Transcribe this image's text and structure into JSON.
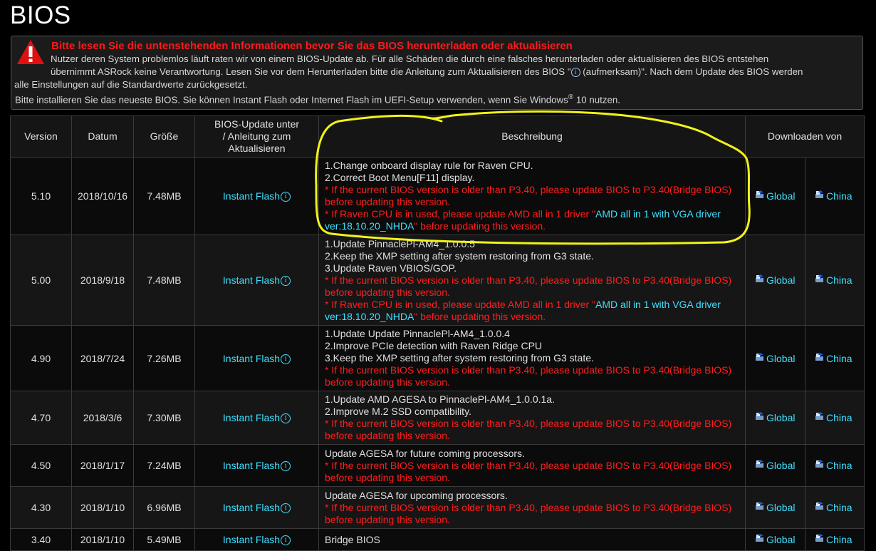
{
  "page": {
    "title": "BIOS"
  },
  "notice": {
    "title": "Bitte lesen Sie die untenstehenden Informationen bevor Sie das BIOS herunterladen oder aktualisieren",
    "body_part1": "Nutzer deren System problemlos läuft raten wir von einem BIOS-Update ab. Für alle Schäden die durch eine falsches herunterladen oder aktualisieren des BIOS entstehen",
    "body_part2": "übernimmt ASRock keine Verantwortung. Lesen Sie vor dem Herunterladen bitte die Anleitung zum Aktualisieren des BIOS \"",
    "body_part3": "(aufmerksam)\". Nach dem Update des BIOS werden",
    "body_part4": "alle Einstellungen auf die Standardwerte zurückgesetzt.",
    "line3_part1": "Bitte installieren Sie das neueste BIOS. Sie können Instant Flash oder Internet Flash im UEFI-Setup verwenden, wenn Sie Windows",
    "line3_reg": "®",
    "line3_part2": " 10 nutzen.",
    "info_glyph": "i"
  },
  "table": {
    "headers": {
      "version": "Version",
      "date": "Datum",
      "size": "Größe",
      "update_l1": "BIOS-Update unter",
      "update_l2": "/ Anleitung zum",
      "update_l3": "Aktualisieren",
      "description": "Beschreibung",
      "download": "Downloaden von"
    },
    "flash_label": "Instant Flash",
    "global_label": "Global",
    "china_label": "China",
    "rows": [
      {
        "version": "5.10",
        "date": "2018/10/16",
        "size": "7.48MB",
        "d1": "1.Change onboard display rule for Raven CPU.",
        "d2": "2.Correct Boot Menu[F11] display.",
        "r1": "* If the current BIOS version is older than P3.40, please update BIOS to P3.40(Bridge BIOS)",
        "r2": "before updating this version.",
        "r3": "* If Raven CPU is in used, please update AMD all in 1 driver \"",
        "c1": "AMD all in 1 with VGA driver",
        "c2": "ver:18.10.20_NHDA",
        "r4": "\" before updating this version."
      },
      {
        "version": "5.00",
        "date": "2018/9/18",
        "size": "7.48MB",
        "d1": "1.Update PinnaclePl-AM4_1.0.0.5",
        "d2": "2.Keep the XMP setting after system restoring from G3 state.",
        "d3": "3.Update Raven VBIOS/GOP.",
        "r1": "* If the current BIOS version is older than P3.40, please update BIOS to P3.40(Bridge BIOS)",
        "r2": "before updating this version.",
        "r3": "* If Raven CPU is in used, please update AMD all in 1 driver \"",
        "c1": "AMD all in 1 with VGA driver",
        "c2": "ver:18.10.20_NHDA",
        "r4": "\" before updating this version."
      },
      {
        "version": "4.90",
        "date": "2018/7/24",
        "size": "7.26MB",
        "d1": "1.Update Update PinnaclePl-AM4_1.0.0.4",
        "d2": "2.Improve PCIe detection with Raven Ridge CPU",
        "d3": "3.Keep the XMP setting after system restoring from G3 state.",
        "r1": "* If the current BIOS version is older than P3.40, please update BIOS to P3.40(Bridge BIOS)",
        "r2": "before updating this version."
      },
      {
        "version": "4.70",
        "date": "2018/3/6",
        "size": "7.30MB",
        "d1": "1.Update AMD AGESA to PinnaclePl-AM4_1.0.0.1a.",
        "d2": "2.Improve M.2 SSD compatibility.",
        "r1": "* If the current BIOS version is older than P3.40, please update BIOS to P3.40(Bridge BIOS)",
        "r2": "before updating this version."
      },
      {
        "version": "4.50",
        "date": "2018/1/17",
        "size": "7.24MB",
        "d1": "Update AGESA for future coming processors.",
        "r1": "* If the current BIOS version is older than P3.40, please update BIOS to P3.40(Bridge BIOS)",
        "r2": "before updating this version."
      },
      {
        "version": "4.30",
        "date": "2018/1/10",
        "size": "6.96MB",
        "d1": "Update AGESA for upcoming processors.",
        "r1": "* If the current BIOS version is older than P3.40, please update BIOS to P3.40(Bridge BIOS)",
        "r2": "before updating this version."
      },
      {
        "version": "3.40",
        "date": "2018/1/10",
        "size": "5.49MB",
        "d1": "Bridge BIOS"
      }
    ]
  },
  "colors": {
    "warning_red": "#ff1a1a",
    "link_cyan": "#3fe0ff",
    "highlight_yellow": "#f2f21a"
  }
}
